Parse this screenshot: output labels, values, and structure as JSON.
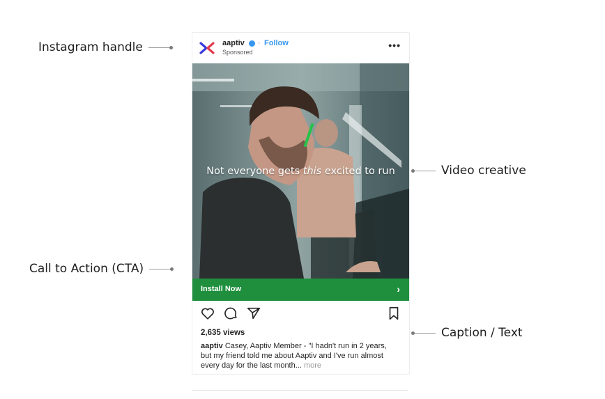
{
  "annotations": {
    "handle": "Instagram handle",
    "video": "Video creative",
    "cta": "Call to Action (CTA)",
    "caption": "Caption / Text"
  },
  "post": {
    "handle": "aaptiv",
    "separator": "·",
    "follow": "Follow",
    "sponsored": "Sponsored",
    "more_menu": "•••",
    "overlay_before": "Not everyone gets ",
    "overlay_italic": "this",
    "overlay_after": " excited to run",
    "cta_label": "Install Now",
    "cta_arrow": "›",
    "views": "2,635 views",
    "caption_handle": "aaptiv",
    "caption_text": " Casey, Aaptiv Member - \"I hadn't run in 2 years, but my friend told me about Aaptiv and I've run almost every day for the last month...",
    "caption_more": " more"
  },
  "icons": {
    "logo": "aaptiv-logo-icon",
    "verified": "verified-badge-icon",
    "like": "heart-icon",
    "comment": "comment-icon",
    "share": "send-icon",
    "save": "bookmark-icon"
  },
  "colors": {
    "cta": "#1f8f3e",
    "follow": "#3897f0",
    "logo_blue": "#3a3ad8",
    "logo_red": "#e23b4e"
  }
}
